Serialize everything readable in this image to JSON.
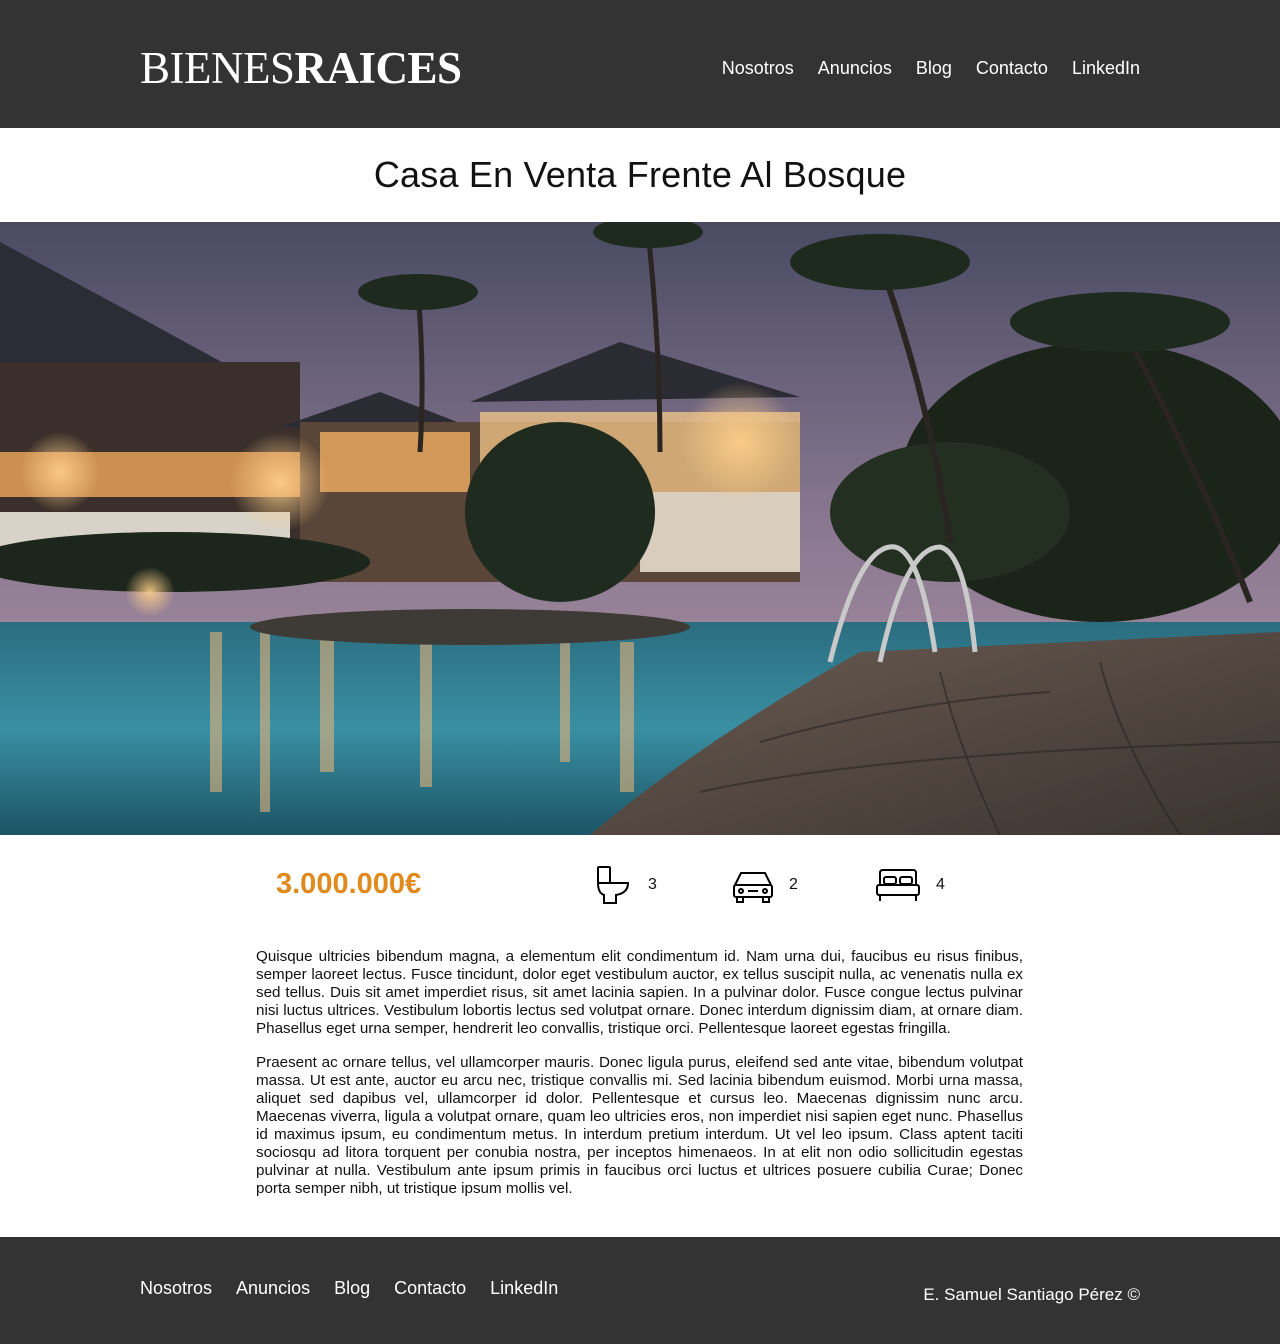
{
  "header": {
    "logo_light": "BIENES",
    "logo_bold": "RAICES",
    "nav": [
      "Nosotros",
      "Anuncios",
      "Blog",
      "Contacto",
      "LinkedIn"
    ]
  },
  "page": {
    "title": "Casa En Venta Frente Al Bosque"
  },
  "hero": {
    "image_icon": "resort-pool-photo"
  },
  "summary": {
    "price": "3.000.000€",
    "features": [
      {
        "icon": "toilet-icon",
        "value": "3"
      },
      {
        "icon": "car-icon",
        "value": "2"
      },
      {
        "icon": "bed-icon",
        "value": "4"
      }
    ],
    "price_color": "#e08a1e"
  },
  "content": {
    "paragraphs": [
      "Quisque ultricies bibendum magna, a elementum elit condimentum id. Nam urna dui, faucibus eu risus finibus, semper laoreet lectus. Fusce tincidunt, dolor eget vestibulum auctor, ex tellus suscipit nulla, ac venenatis nulla ex sed tellus. Duis sit amet imperdiet risus, sit amet lacinia sapien. In a pulvinar dolor. Fusce congue lectus pulvinar nisi luctus ultrices. Vestibulum lobortis lectus sed volutpat ornare. Donec interdum dignissim diam, at ornare diam. Phasellus eget urna semper, hendrerit leo convallis, tristique orci. Pellentesque laoreet egestas fringilla.",
      "Praesent ac ornare tellus, vel ullamcorper mauris. Donec ligula purus, eleifend sed ante vitae, bibendum volutpat massa. Ut est ante, auctor eu arcu nec, tristique convallis mi. Sed lacinia bibendum euismod. Morbi urna massa, aliquet sed dapibus vel, ullamcorper id dolor. Pellentesque et cursus leo. Maecenas dignissim nunc arcu. Maecenas viverra, ligula a volutpat ornare, quam leo ultricies eros, non imperdiet nisi sapien eget nunc. Phasellus id maximus ipsum, eu condimentum metus. In interdum pretium interdum. Ut vel leo ipsum. Class aptent taciti sociosqu ad litora torquent per conubia nostra, per inceptos himenaeos. In at elit non odio sollicitudin egestas pulvinar at nulla. Vestibulum ante ipsum primis in faucibus orci luctus et ultrices posuere cubilia Curae; Donec porta semper nibh, ut tristique ipsum mollis vel."
    ]
  },
  "footer": {
    "nav": [
      "Nosotros",
      "Anuncios",
      "Blog",
      "Contacto",
      "LinkedIn"
    ],
    "copyright": "E. Samuel Santiago Pérez ©"
  },
  "colors": {
    "header_bg": "#333333",
    "accent": "#e08a1e"
  }
}
